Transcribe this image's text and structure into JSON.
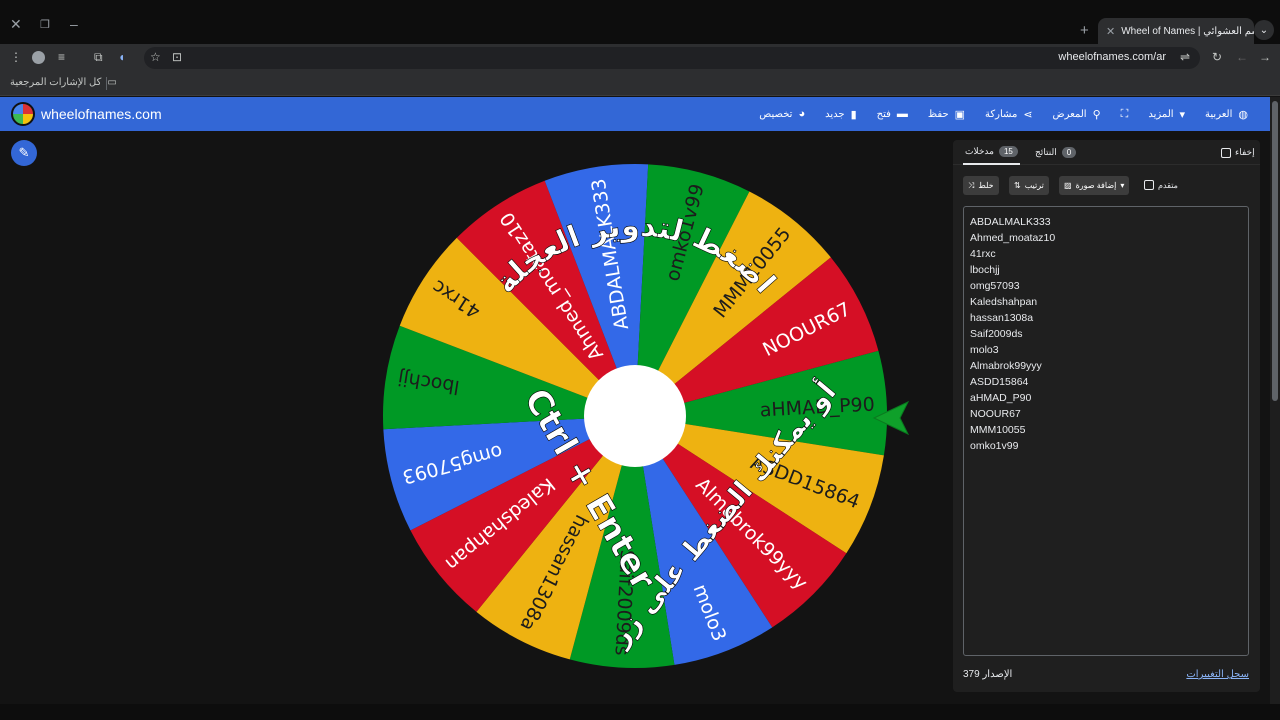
{
  "browser": {
    "tab_title": "Wheel of Names | سم العشوائي",
    "url": "wheelofnames.com/ar",
    "bookmarks_label": "كل الإشارات المرجعية"
  },
  "app": {
    "site_name": "wheelofnames.com",
    "menu": [
      {
        "label": "تخصيص",
        "icon": "palette-icon"
      },
      {
        "label": "جديد",
        "icon": "file-icon"
      },
      {
        "label": "فتح",
        "icon": "folder-icon"
      },
      {
        "label": "حفظ",
        "icon": "save-icon"
      },
      {
        "label": "مشاركة",
        "icon": "share-icon"
      },
      {
        "label": "المعرض",
        "icon": "search-icon"
      },
      {
        "label": "",
        "icon": "fullscreen-icon"
      },
      {
        "label": "المزيد",
        "icon": "chevron-down-icon"
      },
      {
        "label": "العربية",
        "icon": "globe-icon"
      }
    ]
  },
  "wheel": {
    "center_hint_line1": "اضغط لتدوير العجلة",
    "center_hint_line2": "أو يمكنك الضغط على زر",
    "shortcut": "Ctrl + Enter",
    "segments": [
      "aHMAD_P90",
      "ASDD15864",
      "Almabrok99yyy",
      "molo3",
      "Saif2009ds",
      "hassan1308a",
      "Kaledshahpan",
      "omg57093",
      "lbochjj",
      "41rxc",
      "Ahmed_moataz10",
      "ABDALMALK333",
      "omko1v99",
      "MMM10055",
      "NOOUR67"
    ],
    "colors": {
      "blue": "#3369e8",
      "green": "#009925",
      "yellow": "#eeb211",
      "red": "#d50f25"
    }
  },
  "panel": {
    "tabs": {
      "entries_label": "مدخلات",
      "entries_count": "15",
      "results_label": "النتائج",
      "results_count": "0"
    },
    "hide_label": "إخفاء",
    "shuffle_label": "خلط",
    "sort_label": "ترتيب",
    "add_image_label": "إضافة صورة",
    "advanced_label": "متقدم",
    "entries": [
      "ABDALMALK333",
      "Ahmed_moataz10",
      "41rxc",
      "lbochjj",
      "omg57093",
      "Kaledshahpan",
      "hassan1308a",
      "Saif2009ds",
      "molo3",
      "Almabrok99yyy",
      "ASDD15864",
      "aHMAD_P90",
      "NOOUR67",
      "MMM10055",
      "omko1v99"
    ],
    "version_label": "الإصدار",
    "version_number": "379",
    "changelog_label": "سجل التغييرات"
  }
}
